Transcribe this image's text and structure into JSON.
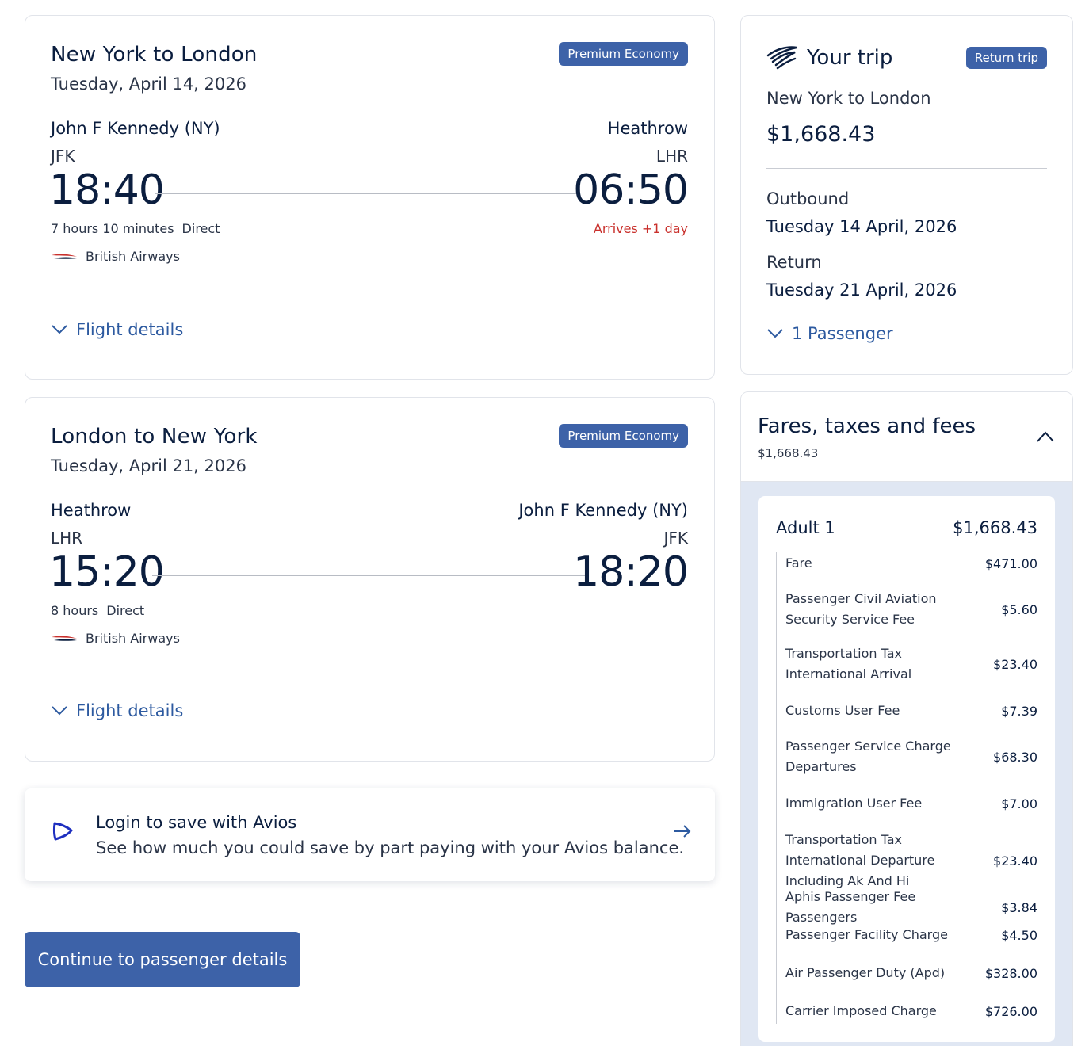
{
  "outbound": {
    "route": "New York to London",
    "date": "Tuesday, April 14, 2026",
    "cabin": "Premium Economy",
    "from_name": "John F Kennedy (NY)",
    "from_code": "JFK",
    "to_name": "Heathrow",
    "to_code": "LHR",
    "depart_time": "18:40",
    "arrive_time": "06:50",
    "duration": "7 hours 10 minutes",
    "stops": "Direct",
    "arrives_note": "Arrives +1 day",
    "airline": "British Airways",
    "details_label": "Flight details"
  },
  "return": {
    "route": "London to New York",
    "date": "Tuesday, April 21, 2026",
    "cabin": "Premium Economy",
    "from_name": "Heathrow",
    "from_code": "LHR",
    "to_name": "John F Kennedy (NY)",
    "to_code": "JFK",
    "depart_time": "15:20",
    "arrive_time": "18:20",
    "duration": "8 hours",
    "stops": "Direct",
    "airline": "British Airways",
    "details_label": "Flight details"
  },
  "avios": {
    "title": "Login to save with Avios",
    "subtitle": "See how much you could save by part paying with your Avios balance."
  },
  "continue_label": "Continue to passenger details",
  "trip": {
    "title": "Your trip",
    "badge": "Return trip",
    "route": "New York to London",
    "price": "$1,668.43",
    "outbound_label": "Outbound",
    "outbound_date": "Tuesday 14 April, 2026",
    "return_label": "Return",
    "return_date": "Tuesday 21 April, 2026",
    "passengers_label": "1 Passenger"
  },
  "fares": {
    "title": "Fares, taxes and fees",
    "total": "$1,668.43",
    "adult_label": "Adult 1",
    "adult_total": "$1,668.43",
    "items": [
      {
        "name": "Fare",
        "amount": "$471.00"
      },
      {
        "name": "Passenger Civil Aviation Security Service Fee",
        "amount": "$5.60"
      },
      {
        "name": "Transportation Tax International Arrival",
        "amount": "$23.40"
      },
      {
        "name": "Customs User Fee",
        "amount": "$7.39"
      },
      {
        "name": "Passenger Service Charge Departures",
        "amount": "$68.30"
      },
      {
        "name": "Immigration User Fee",
        "amount": "$7.00"
      },
      {
        "name": "Transportation Tax International Departure Including Ak And Hi",
        "amount": "$23.40"
      },
      {
        "name": "Aphis Passenger Fee Passengers",
        "amount": "$3.84"
      },
      {
        "name": "Passenger Facility Charge",
        "amount": "$4.50"
      },
      {
        "name": "Air Passenger Duty (Apd)",
        "amount": "$328.00"
      },
      {
        "name": "Carrier Imposed Charge",
        "amount": "$726.00"
      }
    ]
  },
  "colors": {
    "brand_blue": "#3d62a8",
    "link_blue": "#2d5aa0",
    "navy_text": "#0b1e3f",
    "alert_red": "#c9302c",
    "panel_tint": "#e0e7f3"
  },
  "icons": {
    "airline_logo": "british-airways-speedmarque-icon",
    "trip": "speedmarque-icon",
    "avios": "avios-icon",
    "expand": "chevron-down-icon",
    "collapse": "chevron-up-icon",
    "go": "arrow-right-icon"
  }
}
